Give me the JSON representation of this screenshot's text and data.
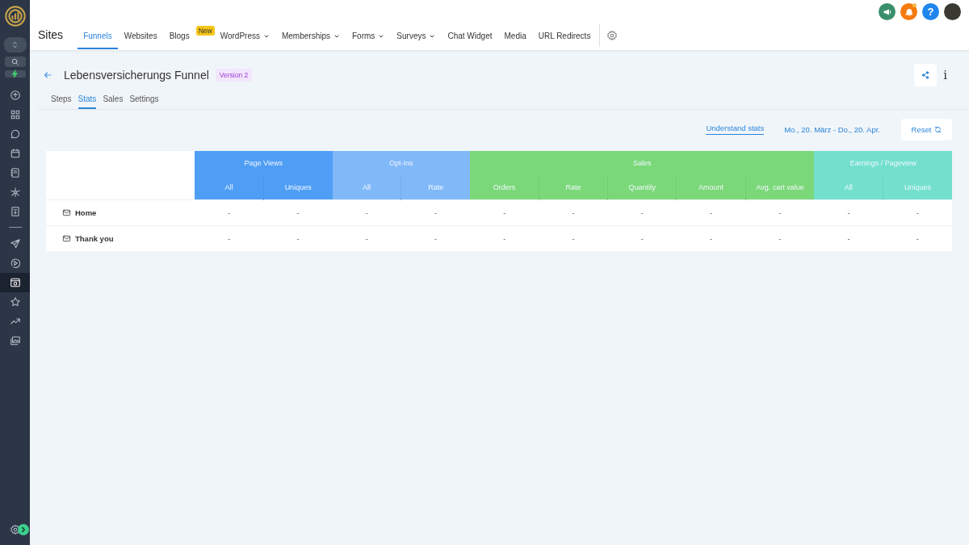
{
  "sidebar": {
    "items": [
      {
        "selected": false
      },
      {
        "selected": false
      },
      {
        "selected": false
      },
      {
        "selected": false
      },
      {
        "selected": false
      },
      {
        "selected": false
      },
      {
        "selected": false
      },
      {
        "selected": false
      },
      {
        "selected": false
      },
      {
        "selected": true
      },
      {
        "selected": false
      },
      {
        "selected": false
      },
      {
        "selected": false
      }
    ]
  },
  "header": {
    "title": "Sites",
    "help": "?",
    "nav": [
      {
        "label": "Funnels",
        "selected": true,
        "dropdown": false
      },
      {
        "label": "Websites",
        "selected": false,
        "dropdown": false
      },
      {
        "label": "Blogs",
        "selected": false,
        "dropdown": false,
        "badge": "New"
      },
      {
        "label": "WordPress",
        "selected": false,
        "dropdown": true
      },
      {
        "label": "Memberships",
        "selected": false,
        "dropdown": true
      },
      {
        "label": "Forms",
        "selected": false,
        "dropdown": true
      },
      {
        "label": "Surveys",
        "selected": false,
        "dropdown": true
      },
      {
        "label": "Chat Widget",
        "selected": false,
        "dropdown": false
      },
      {
        "label": "Media",
        "selected": false,
        "dropdown": false
      },
      {
        "label": "URL Redirects",
        "selected": false,
        "dropdown": false
      }
    ]
  },
  "funnel": {
    "title": "Lebensversicherungs Funnel",
    "version": "Version 2",
    "info": "i"
  },
  "tabs": [
    {
      "label": "Steps",
      "selected": false
    },
    {
      "label": "Stats",
      "selected": true
    },
    {
      "label": "Sales",
      "selected": false
    },
    {
      "label": "Settings",
      "selected": false
    }
  ],
  "toolbar": {
    "link": "Understand stats",
    "date_range": "Mo., 20. März - Do., 20. Apr.",
    "reset": "Reset"
  },
  "table": {
    "groups": [
      {
        "label": "Page Views",
        "color": "#4f9ef5",
        "columns": [
          "All",
          "Uniques"
        ]
      },
      {
        "label": "Opt-Ins",
        "color": "#80b8f8",
        "columns": [
          "All",
          "Rate"
        ]
      },
      {
        "label": "Sales",
        "color": "#7bd879",
        "columns": [
          "Orders",
          "Rate",
          "Quantity",
          "Amount",
          "Avg. cart value"
        ]
      },
      {
        "label": "Earnings / Pageview",
        "color": "#73e0cd",
        "columns": [
          "All",
          "Uniques"
        ]
      }
    ],
    "rows": [
      {
        "name": "Home",
        "cells": [
          "-",
          "-",
          "-",
          "-",
          "-",
          "-",
          "-",
          "-",
          "-",
          "-",
          "-"
        ]
      },
      {
        "name": "Thank you",
        "cells": [
          "-",
          "-",
          "-",
          "-",
          "-",
          "-",
          "-",
          "-",
          "-",
          "-",
          "-"
        ]
      }
    ]
  }
}
